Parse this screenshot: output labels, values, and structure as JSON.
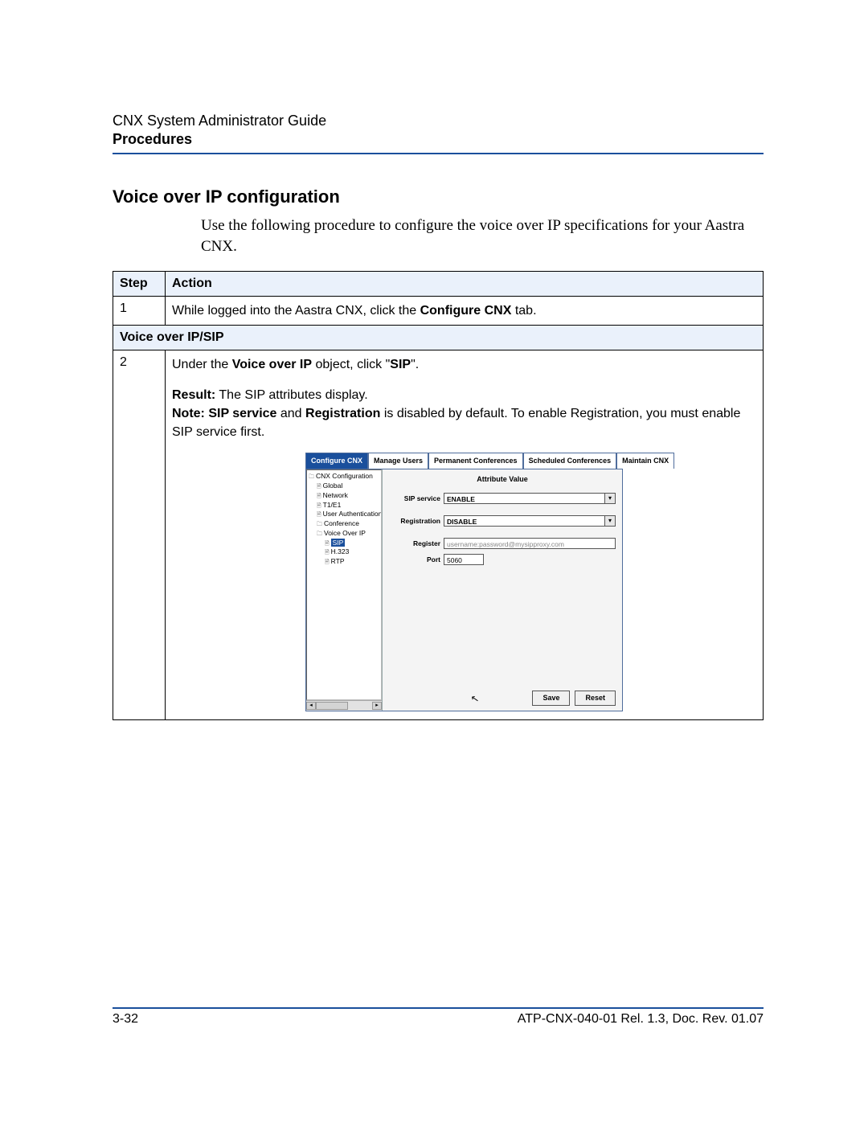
{
  "header": {
    "doc_title": "CNX System Administrator Guide",
    "doc_subtitle": "Procedures"
  },
  "section_title": "Voice over IP configuration",
  "intro": "Use the following procedure to configure the voice over IP specifications for your Aastra CNX.",
  "table": {
    "col_step": "Step",
    "col_action": "Action",
    "step1_num": "1",
    "step1_pre": "While logged into the Aastra CNX, click the ",
    "step1_bold": "Configure CNX",
    "step1_post": " tab.",
    "subhead": "Voice over IP/SIP",
    "step2_num": "2",
    "step2_l1_pre": "Under the ",
    "step2_l1_b1": "Voice over IP",
    "step2_l1_mid": " object, click \"",
    "step2_l1_b2": "SIP",
    "step2_l1_post": "\".",
    "step2_res_b": "Result:",
    "step2_res_t": " The SIP attributes display.",
    "step2_note_b1": "Note: SIP service",
    "step2_note_mid1": " and ",
    "step2_note_b2": "Registration",
    "step2_note_post": " is disabled by default. To enable Registration, you must enable SIP service first."
  },
  "embed": {
    "tabs": [
      "Configure CNX",
      "Manage Users",
      "Permanent Conferences",
      "Scheduled Conferences",
      "Maintain CNX"
    ],
    "tree": {
      "root": "CNX Configuration",
      "global": "Global",
      "network": "Network",
      "t1e1": "T1/E1",
      "user_auth": "User Authentication",
      "conference": "Conference",
      "voip": "Voice Over IP",
      "sip": "SIP",
      "h323": "H.323",
      "rtp": "RTP"
    },
    "attr_header": "Attribute Value",
    "fields": {
      "sip_service_label": "SIP service",
      "sip_service_value": "ENABLE",
      "registration_label": "Registration",
      "registration_value": "DISABLE",
      "register_label": "Register",
      "register_value": "username:password@mysipproxy.com",
      "port_label": "Port",
      "port_value": "5060"
    },
    "buttons": {
      "save": "Save",
      "reset": "Reset"
    }
  },
  "footer": {
    "page_num": "3-32",
    "doc_ref": "ATP-CNX-040-01 Rel. 1.3, Doc. Rev. 01.07"
  }
}
